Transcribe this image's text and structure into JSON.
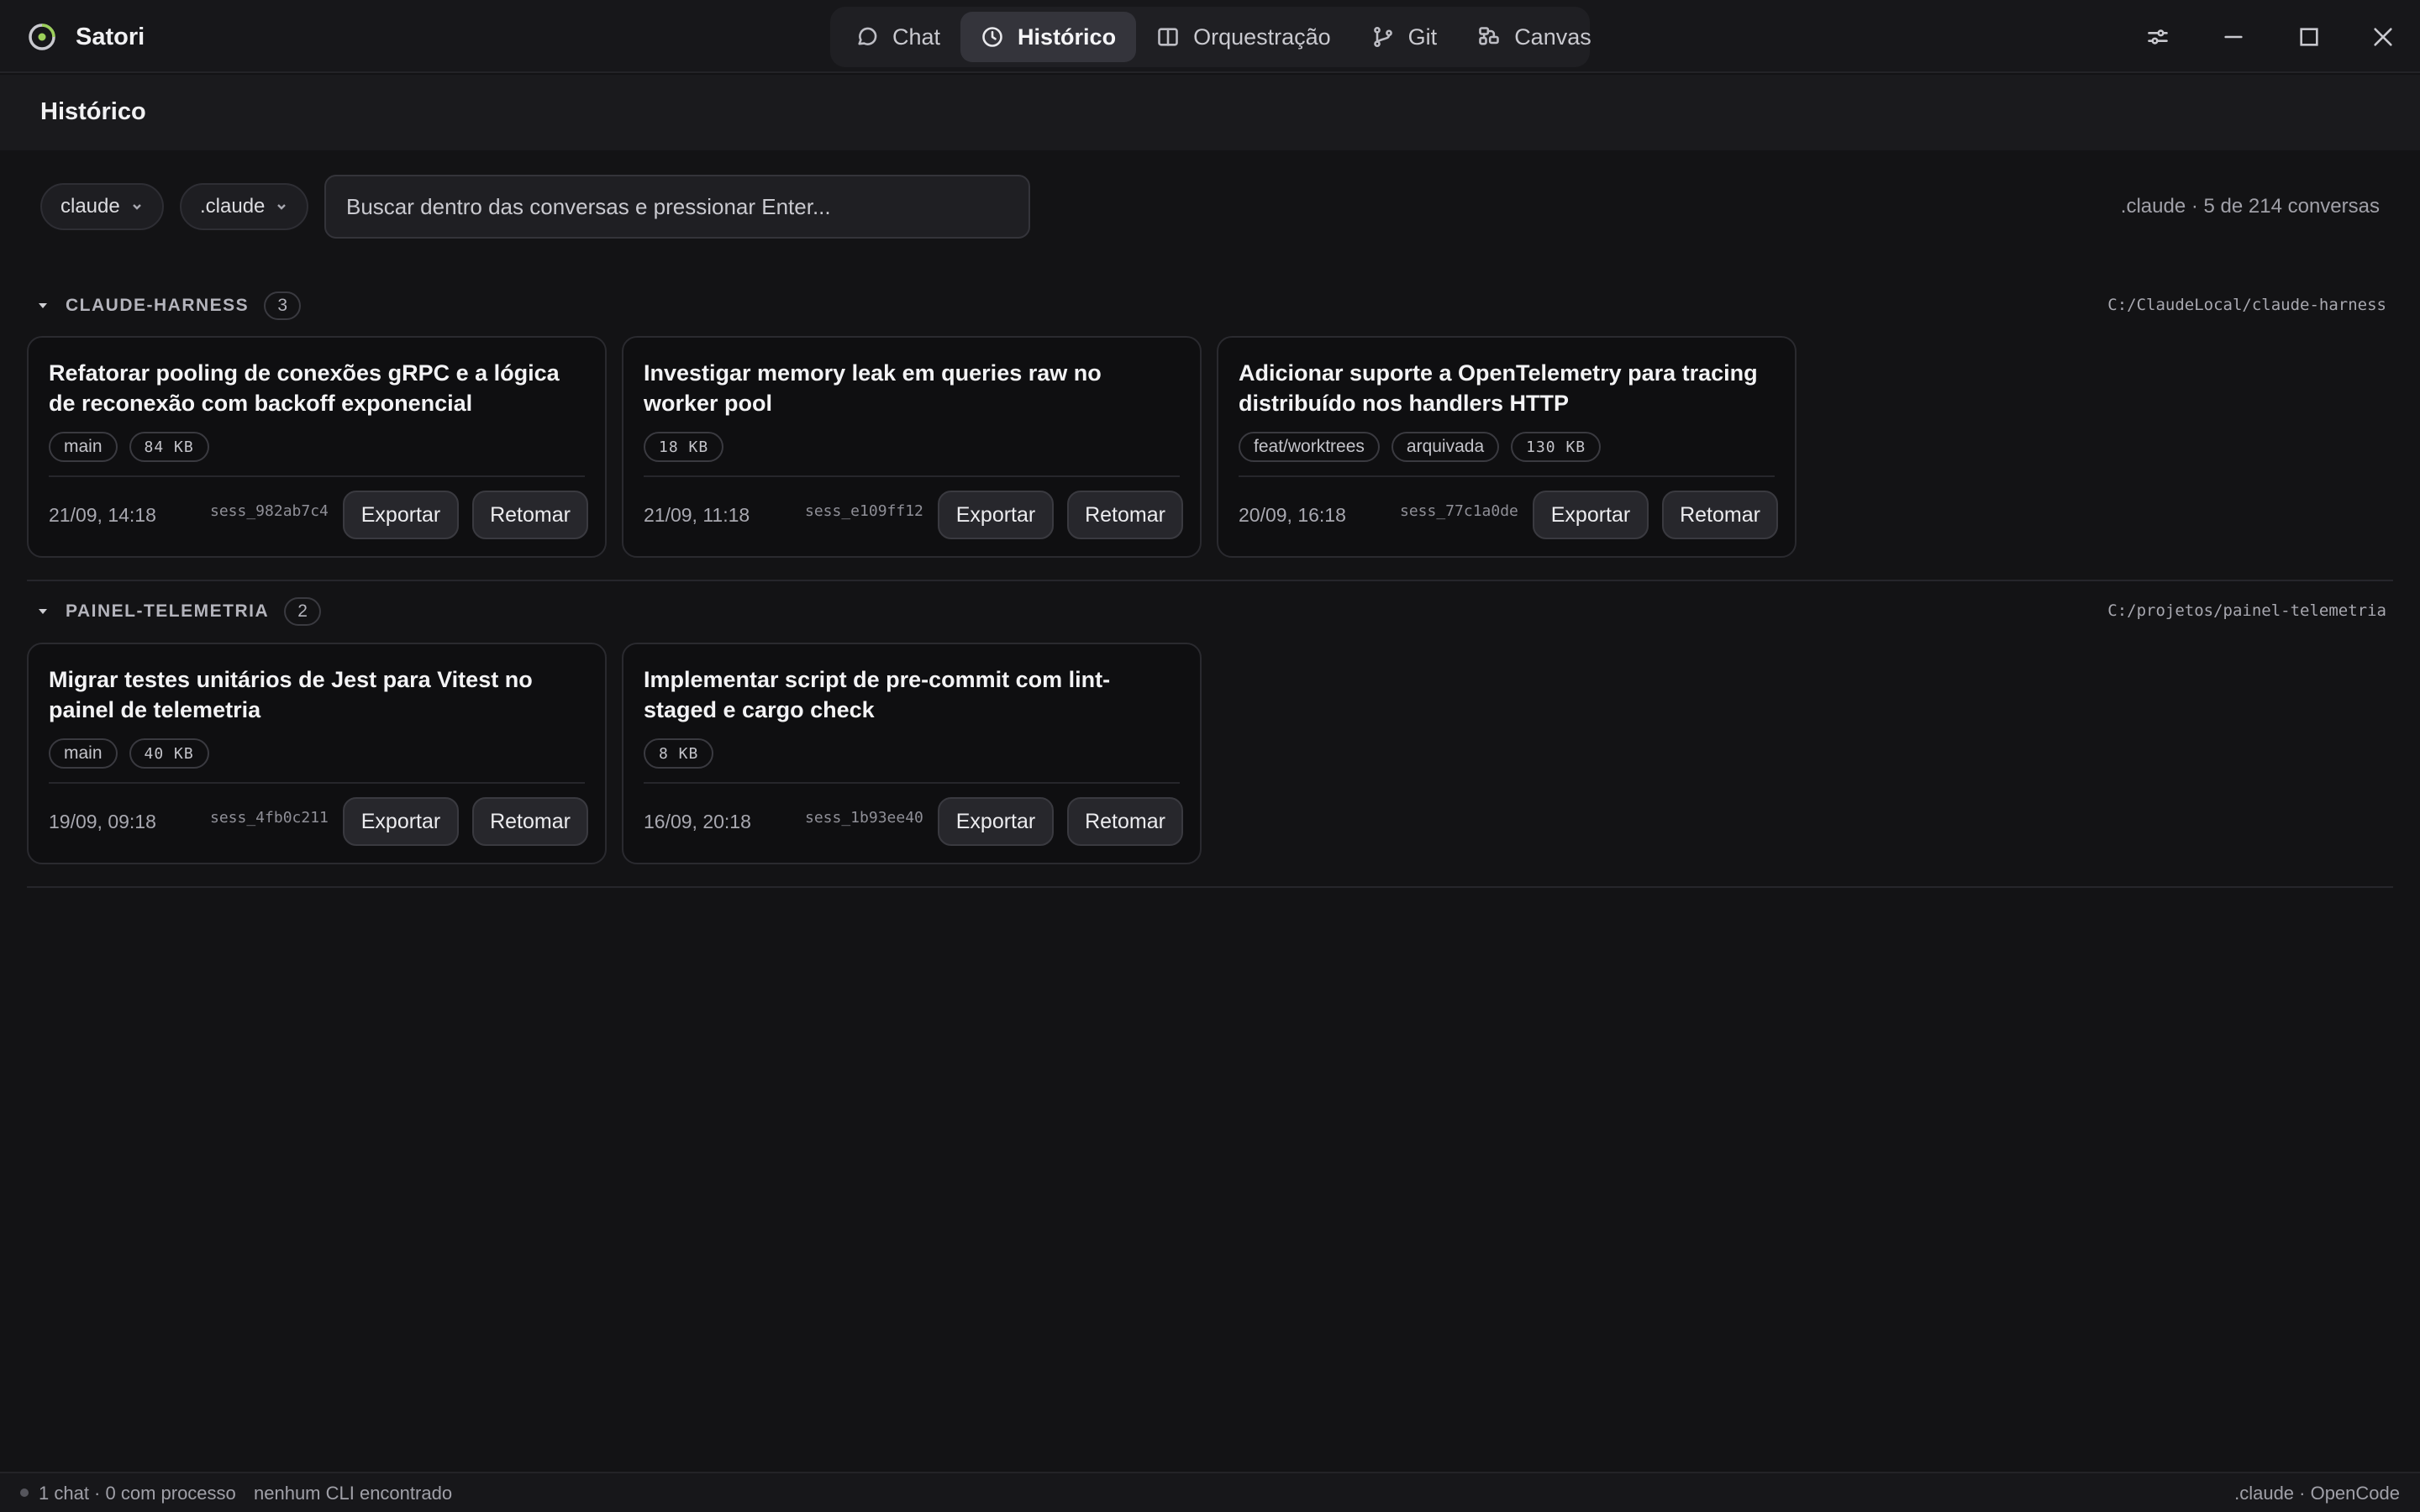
{
  "app": {
    "title": "Satori",
    "accent": "#9ccf5a"
  },
  "nav": {
    "tabs": [
      {
        "label": "Chat",
        "icon": "chat-bubble-icon"
      },
      {
        "label": "Histórico",
        "icon": "clock-icon",
        "active": true
      },
      {
        "label": "Orquestração",
        "icon": "columns-icon"
      },
      {
        "label": "Git",
        "icon": "git-branch-icon"
      },
      {
        "label": "Canvas",
        "icon": "canvas-icon"
      }
    ]
  },
  "window": {
    "controls": [
      "settings-sliders-icon",
      "minimize-icon",
      "maximize-icon",
      "close-icon"
    ]
  },
  "page": {
    "title": "Histórico"
  },
  "filters": {
    "provider": "claude",
    "folder": ".claude",
    "search_placeholder": "Buscar dentro das conversas e pressionar Enter...",
    "summary": ".claude · 5 de 214 conversas"
  },
  "groups": [
    {
      "name": "CLAUDE-HARNESS",
      "count": "3",
      "path": "C:/ClaudeLocal/claude-harness",
      "cards": [
        {
          "title": "Refatorar pooling de conexões gRPC e a lógica de reconexão com backoff exponencial",
          "tags": [
            "main",
            "84 KB"
          ],
          "date": "21/09, 14:18",
          "session": "sess_982ab7c4",
          "export_label": "Exportar",
          "resume_label": "Retomar"
        },
        {
          "title": "Investigar memory leak em queries raw no worker pool",
          "tags": [
            "18 KB"
          ],
          "date": "21/09, 11:18",
          "session": "sess_e109ff12",
          "export_label": "Exportar",
          "resume_label": "Retomar"
        },
        {
          "title": "Adicionar suporte a OpenTelemetry para tracing distribuído nos handlers HTTP",
          "tags": [
            "feat/worktrees",
            "arquivada",
            "130 KB"
          ],
          "date": "20/09, 16:18",
          "session": "sess_77c1a0de",
          "export_label": "Exportar",
          "resume_label": "Retomar"
        }
      ]
    },
    {
      "name": "PAINEL-TELEMETRIA",
      "count": "2",
      "path": "C:/projetos/painel-telemetria",
      "cards": [
        {
          "title": "Migrar testes unitários de Jest para Vitest no painel de telemetria",
          "tags": [
            "main",
            "40 KB"
          ],
          "date": "19/09, 09:18",
          "session": "sess_4fb0c211",
          "export_label": "Exportar",
          "resume_label": "Retomar"
        },
        {
          "title": "Implementar script de pre-commit com lint-staged e cargo check",
          "tags": [
            "8 KB"
          ],
          "date": "16/09, 20:18",
          "session": "sess_1b93ee40",
          "export_label": "Exportar",
          "resume_label": "Retomar"
        }
      ]
    }
  ],
  "status": {
    "left": "1 chat · 0 com processo",
    "middle": "nenhum CLI encontrado",
    "right": ".claude · OpenCode"
  }
}
